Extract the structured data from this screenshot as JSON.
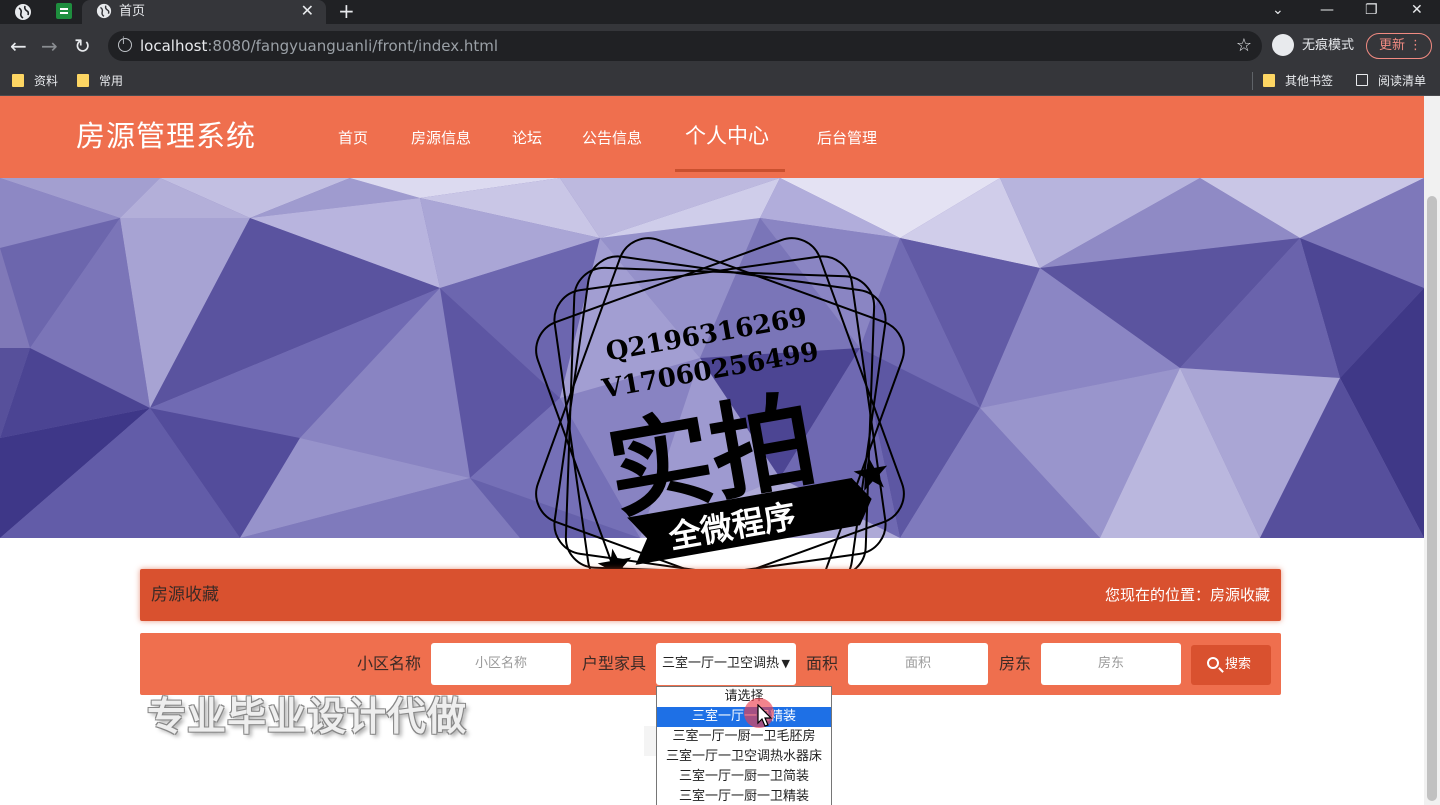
{
  "browser": {
    "active_tab_title": "首页",
    "url_host": "localhost",
    "url_rest": ":8080/fangyuanguanli/front/index.html",
    "incognito_label": "无痕模式",
    "update_label": "更新",
    "bookmarks": [
      "资料",
      "常用"
    ],
    "bookmarks_right": [
      "其他书签",
      "阅读清单"
    ]
  },
  "site": {
    "logo": "房源管理系统",
    "nav": [
      "首页",
      "房源信息",
      "论坛",
      "公告信息",
      "个人中心",
      "后台管理"
    ],
    "active_nav": "个人中心"
  },
  "stamp": {
    "line1": "Q2196316269",
    "line2": "V17060256499",
    "big": "实拍",
    "ribbon": "全微程序"
  },
  "title_bar": {
    "title": "房源收藏",
    "location_prefix": "您现在的位置：",
    "location_value": "房源收藏"
  },
  "search": {
    "community_label": "小区名称",
    "community_placeholder": "小区名称",
    "furniture_label": "户型家具",
    "furniture_selected": "三室一厅一卫空调热",
    "area_label": "面积",
    "area_placeholder": "面积",
    "landlord_label": "房东",
    "landlord_placeholder": "房东",
    "button_label": "搜索"
  },
  "dropdown_options": [
    "请选择",
    "三室一厅一卫精装",
    "三室一厅一厨一卫毛胚房",
    "三室一厅一卫空调热水器床",
    "三室一厅一厨一卫简装",
    "三室一厅一厨一卫精装"
  ],
  "dropdown_selected_index": 1,
  "watermark": "专业毕业设计代做",
  "colors": {
    "header": "#ef6f4e",
    "title_bar": "#d9512f",
    "banner": "#8079b8"
  }
}
